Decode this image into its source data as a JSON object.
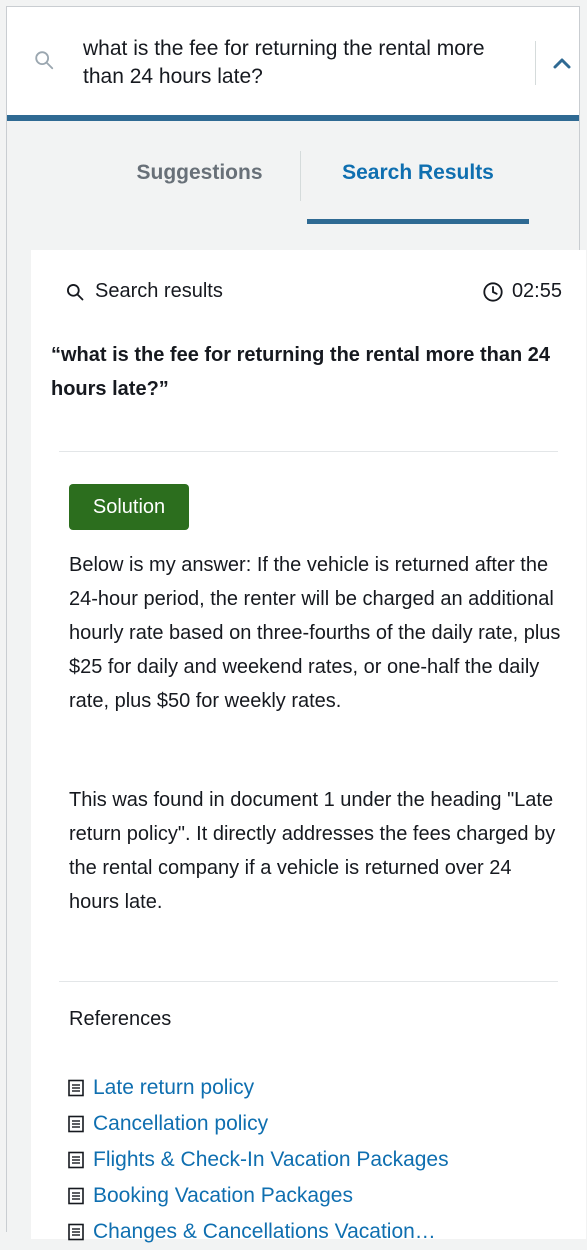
{
  "search": {
    "query_text": "what is the fee for returning the rental more than 24 hours late?"
  },
  "tabs": [
    {
      "label": "Suggestions",
      "active": false
    },
    {
      "label": "Search Results",
      "active": true
    }
  ],
  "results": {
    "header_label": "Search results",
    "timer": "02:55",
    "quoted_query": "“what is the fee for returning the rental more than 24 hours late?”",
    "badge": "Solution",
    "answer": "Below is my answer: If the vehicle is returned after the 24-hour period, the renter will be charged an additional hourly rate based on three-fourths of the daily rate, plus $25 for daily and weekend rates, or one-half the daily rate, plus $50 for weekly rates.",
    "explanation": "This was found in document 1 under the heading \"Late return policy\". It directly addresses the fees charged by the rental company if a vehicle is returned over 24 hours late.",
    "references_title": "References",
    "references": [
      "Late return policy",
      "Cancellation policy",
      "Flights & Check-In Vacation Packages",
      "Booking Vacation Packages",
      "Changes & Cancellations Vacation…"
    ]
  },
  "colors": {
    "accent": "#2f6a93",
    "link": "#0f6fb0",
    "badge": "#2c6e1e"
  }
}
